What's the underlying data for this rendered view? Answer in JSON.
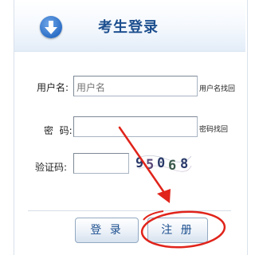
{
  "header": {
    "title": "考生登录",
    "icon": "download-arrow-icon",
    "accent": "#2d6fc7"
  },
  "form": {
    "username": {
      "label": "用户名:",
      "value": "",
      "placeholder": "用户名",
      "recover_link": "用户名找回"
    },
    "password": {
      "label": "密  码:",
      "value": "",
      "recover_link": "密码找回"
    },
    "captcha": {
      "label": "验证码:",
      "value": "",
      "image_text": "95068"
    }
  },
  "actions": {
    "login_label": "登 录",
    "register_label": "注 册"
  },
  "annotation": {
    "color": "#e0241b"
  }
}
